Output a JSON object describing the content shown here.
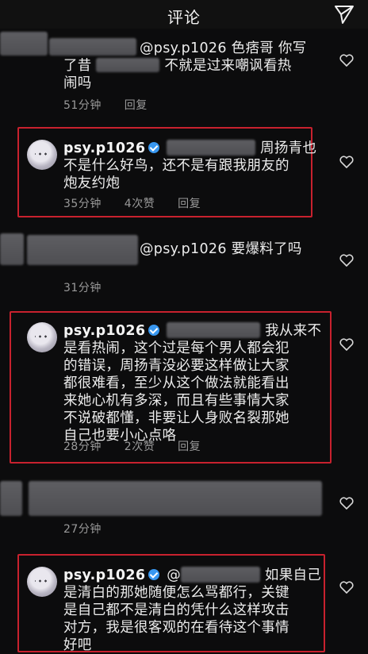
{
  "header": {
    "title": "评论",
    "send_icon": "send-icon"
  },
  "comments": [
    {
      "line1_mention": "@psy.p1026 色痞哥 你写",
      "line2_prefix": "了昔",
      "line2_suffix": "不就是过来嘲讽看热",
      "line3": "闹吗",
      "time": "51分钟",
      "reply": "回复"
    },
    {
      "user": "psy.p1026",
      "line1_tail": "周扬青也",
      "line2": "不是什么好鸟，还不是有跟我朋友的",
      "line3": "炮友约炮",
      "time": "35分钟",
      "likes": "4次赞",
      "reply": "回复"
    },
    {
      "mention": "@psy.p1026 要爆料了吗",
      "time": "31分钟"
    },
    {
      "user": "psy.p1026",
      "line1_tail": "我从来不",
      "line2": "是看热闹，这个过是每个男人都会犯",
      "line3": "的错误，周扬青没必要这样做让大家",
      "line4": "都很难看，至少从这个做法就能看出",
      "line5": "来她心机有多深，而且有些事情大家",
      "line6": "不说破都懂，非要让人身败名裂那她",
      "line7": "自己也要小心点咯",
      "time": "28分钟",
      "likes": "2次赞",
      "reply": "回复"
    },
    {
      "time": "27分钟"
    },
    {
      "user": "psy.p1026",
      "line1_mention": "@",
      "line1_tail": "如果自己",
      "line2": "是清白的那她随便怎么骂都行，关键",
      "line3": "是自己都不是清白的凭什么这样攻击",
      "line4": "对方，我是很客观的在看待这个事情",
      "line5": "好吧"
    }
  ],
  "colors": {
    "highlight_border": "#c8212e",
    "verified": "#3897f0",
    "background": "#0c0c0d"
  }
}
